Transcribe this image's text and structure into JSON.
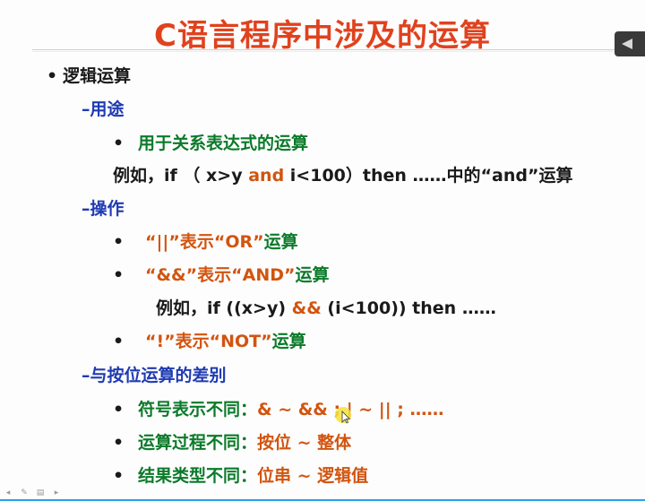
{
  "slide": {
    "title": "C语言程序中涉及的运算",
    "l1": "逻辑运算",
    "uses_label": "–用途",
    "uses_item": "用于关系表达式的运算",
    "example1_pre": "例如，if （",
    "example1_a": "x>y",
    "example1_and": "and",
    "example1_b": "i<100",
    "example1_post": "）then ……中的“and”运算",
    "ops_label": "–操作",
    "op1_pre": "“||”表示",
    "op1_q": "“OR”",
    "op1_post": "运算",
    "op2_pre": "“&&”表示",
    "op2_q": "“AND”",
    "op2_post": "运算",
    "example2_pre": "例如，",
    "example2_if": "if ((x>y)",
    "example2_amp": "&&",
    "example2_rest": "(i<100)) then ……",
    "op3_pre": "“!”表示",
    "op3_q": "“NOT”",
    "op3_post": "运算",
    "diff_label": "–与按位运算的差别",
    "diff1_label": "符号表示不同：",
    "diff1_value": "& ~ &&  ; | ~ || ;  ……",
    "diff2_label": "运算过程不同：",
    "diff2_value": "按位 ~ 整体",
    "diff3_label": "结果类型不同：",
    "diff3_value": "位串 ~ 逻辑值"
  },
  "colors": {
    "title": "#e0421e",
    "heading": "#1f3bb3",
    "body": "#0b7a2a",
    "accent": "#d2540f"
  },
  "icons": [
    "slide-nav-back-icon",
    "mouse-cursor-icon",
    "slide-control-icons"
  ]
}
